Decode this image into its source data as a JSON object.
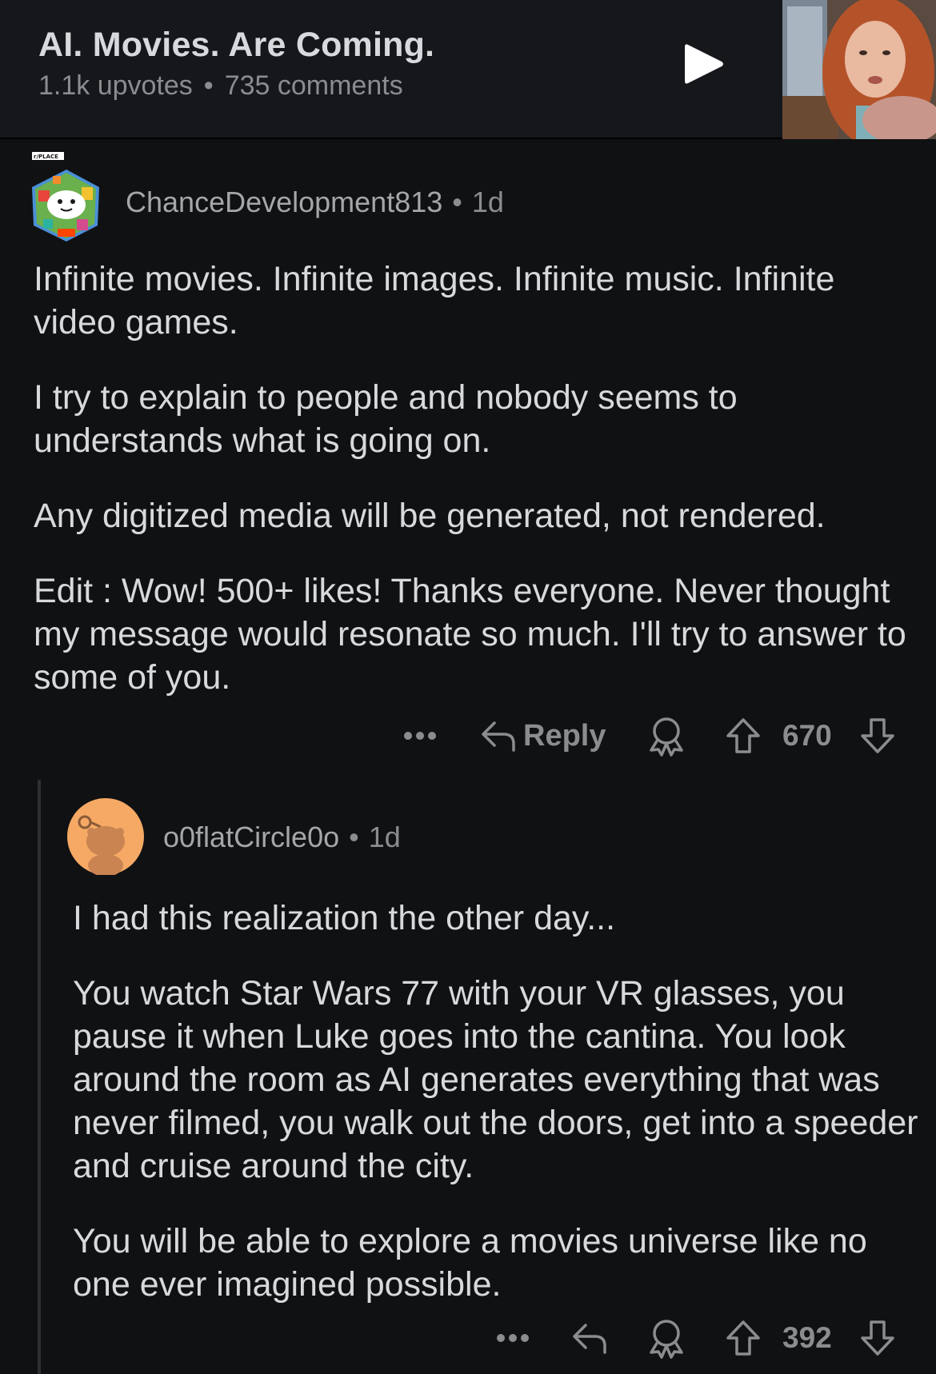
{
  "post": {
    "title": "AI. Movies. Are Coming.",
    "upvotes": "1.1k upvotes",
    "separator": "•",
    "comments": "735 comments"
  },
  "comments": [
    {
      "username": "ChanceDevelopment813",
      "separator": "•",
      "age": "1d",
      "avatar_badge": "r/PLACE",
      "paragraphs": [
        "Infinite movies. Infinite images. Infinite music. Infinite video games.",
        "I try to explain to people and nobody seems to understands what is going on.",
        "Any digitized media will be generated, not rendered.",
        "Edit : Wow! 500+ likes! Thanks everyone. Never thought my message would resonate so much. I'll try to answer to some of you."
      ],
      "actions": {
        "more": "•••",
        "reply_label": "Reply",
        "score": "670"
      }
    },
    {
      "username": "o0flatCircle0o",
      "separator": "•",
      "age": "1d",
      "paragraphs": [
        "I had this realization the other day...",
        "You watch Star Wars 77 with your VR glasses, you pause it when Luke goes into the cantina. You look around the room as AI generates everything that was never filmed, you walk out the doors, get into a speeder and cruise around the city.",
        "You will be able to explore a movies universe like no one ever imagined possible."
      ],
      "actions": {
        "more": "•••",
        "score": "392"
      }
    }
  ],
  "colors": {
    "background": "#101113",
    "header_background": "#15171a",
    "text": "#d7dadc",
    "meta": "#8a8d90",
    "avatar_orange": "#f5a964"
  },
  "icons": [
    "play-icon",
    "reply-arrow-icon",
    "award-icon",
    "upvote-icon",
    "downvote-icon",
    "more-icon"
  ]
}
